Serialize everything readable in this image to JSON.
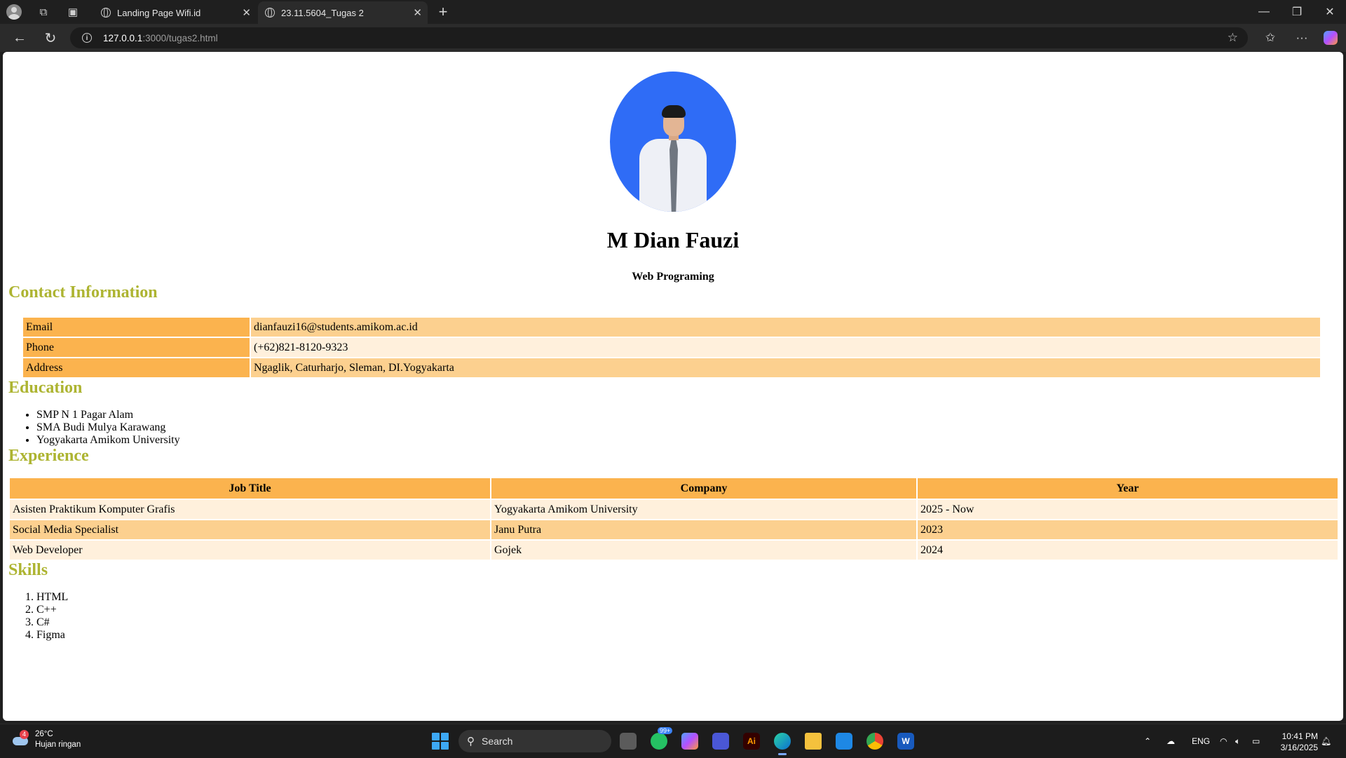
{
  "browser": {
    "tabs": [
      {
        "title": "Landing Page Wifi.id",
        "active": false
      },
      {
        "title": "23.11.5604_Tugas 2",
        "active": true
      }
    ],
    "url_host": "127.0.0.1",
    "url_path": ":3000/tugas2.html"
  },
  "profile": {
    "name": "M Dian Fauzi",
    "role": "Web Programing",
    "avatar_bg": "#2f6cf6"
  },
  "contact": {
    "title": "Contact Information",
    "rows": [
      {
        "label": "Email",
        "value": "dianfauzi16@students.amikom.ac.id"
      },
      {
        "label": "Phone",
        "value": "(+62)821-8120-9323"
      },
      {
        "label": "Address",
        "value": "Ngaglik, Caturharjo, Sleman, DI.Yogyakarta"
      }
    ]
  },
  "education": {
    "title": "Education",
    "items": [
      "SMP N 1 Pagar Alam",
      "SMA Budi Mulya Karawang",
      "Yogyakarta Amikom University"
    ]
  },
  "experience": {
    "title": "Experience",
    "headers": [
      "Job Title",
      "Company",
      "Year"
    ],
    "rows": [
      [
        "Asisten Praktikum Komputer Grafis",
        "Yogyakarta Amikom University",
        "2025 - Now"
      ],
      [
        "Social Media Specialist",
        "Janu Putra",
        "2023"
      ],
      [
        "Web Developer",
        "Gojek",
        "2024"
      ]
    ]
  },
  "skills": {
    "title": "Skills",
    "items": [
      "HTML",
      "C++",
      "C#",
      "Figma"
    ]
  },
  "colors": {
    "heading": "#adb431",
    "table_header": "#fbb34e",
    "row_dark": "#fcd08f",
    "row_light": "#fff0dc"
  },
  "taskbar": {
    "weather_temp": "26°C",
    "weather_desc": "Hujan ringan",
    "weather_badge": "4",
    "search_placeholder": "Search",
    "notif_badge": "99+",
    "language": "ENG",
    "time": "10:41 PM",
    "date": "3/16/2025"
  }
}
